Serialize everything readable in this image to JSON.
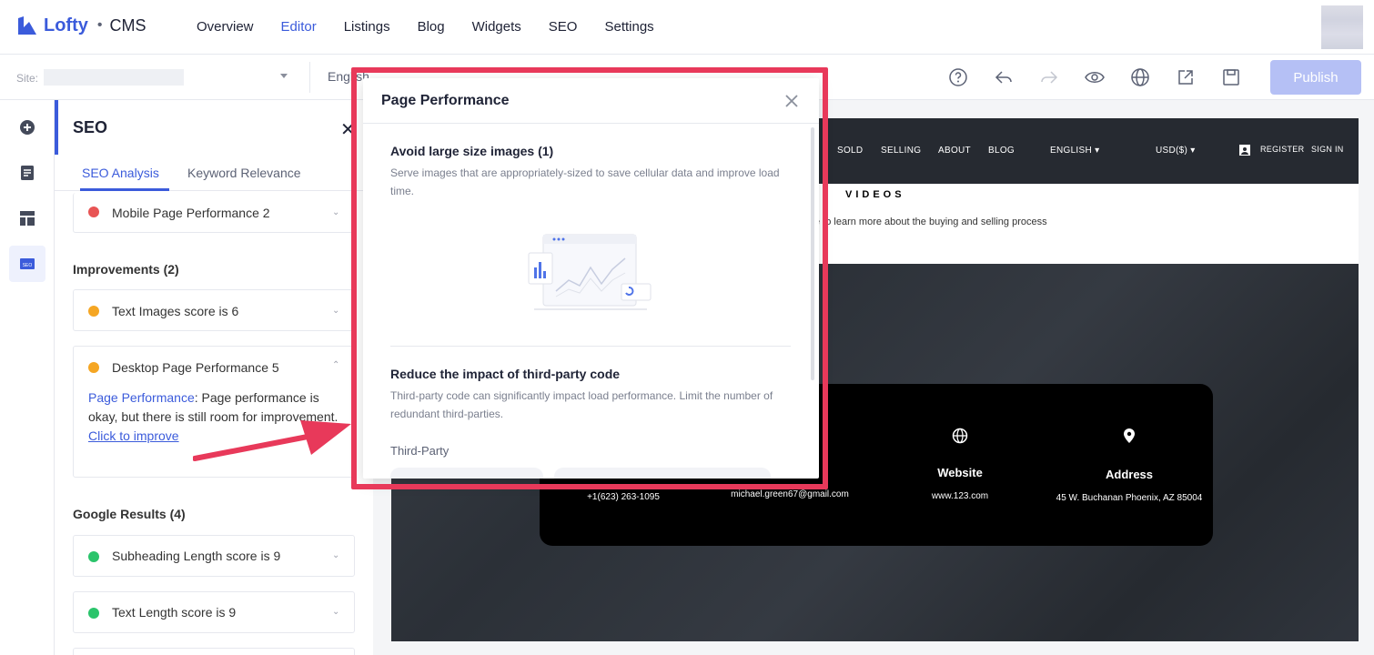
{
  "app": {
    "brand": "Lofty",
    "separator": "•",
    "product": "CMS",
    "accent": "#3b5bdb"
  },
  "nav": {
    "items": [
      "Overview",
      "Editor",
      "Listings",
      "Blog",
      "Widgets",
      "SEO",
      "Settings"
    ],
    "active": "Editor"
  },
  "toolbar": {
    "site_label": "Site:",
    "language": "English",
    "icons": [
      "help-icon",
      "undo-icon",
      "redo-icon",
      "preview-eye-icon",
      "globe-icon",
      "share-icon",
      "save-icon"
    ],
    "publish_label": "Publish"
  },
  "rail": {
    "icons": [
      "add-icon",
      "page-icon",
      "layout-icon",
      "seo-icon"
    ],
    "active": "seo-icon"
  },
  "seo_panel": {
    "title": "SEO",
    "close": "✕",
    "tabs": [
      "SEO Analysis",
      "Keyword Relevance"
    ],
    "top_item": {
      "label": "Mobile Page Performance 2",
      "status": "red"
    },
    "improvements": {
      "heading": "Improvements (2)",
      "items": [
        {
          "label": "Text Images score is 6",
          "status": "orange"
        },
        {
          "label": "Desktop Page Performance 5",
          "status": "orange",
          "expanded": true
        }
      ],
      "expanded_detail": {
        "link_label": "Page Performance",
        "text": ": Page performance is okay, but there is still room for improvement.",
        "action": "Click to improve"
      }
    },
    "google_results": {
      "heading": "Google Results (4)",
      "items": [
        {
          "label": "Subheading Length score is 9",
          "status": "green"
        },
        {
          "label": "Text Length score is 9",
          "status": "green"
        }
      ]
    }
  },
  "preview": {
    "nav": [
      "SOLD",
      "SELLING",
      "ABOUT",
      "BLOG",
      "ENGLISH ▾",
      "USD($) ▾",
      "REGISTER",
      "SIGN IN"
    ],
    "section_title": "VIDEOS",
    "section_sub": "e to learn more about the buying and selling process",
    "contact": [
      {
        "title": "",
        "value": "+1(623) 263-1095"
      },
      {
        "title": "",
        "value": "michael.green67@gmail.com"
      },
      {
        "title": "Website",
        "value": "www.123.com"
      },
      {
        "title": "Address",
        "value": "45 W. Buchanan Phoenix, AZ 85004"
      }
    ]
  },
  "modal": {
    "title": "Page Performance",
    "sections": [
      {
        "heading": "Avoid large size images (1)",
        "text": "Serve images that are appropriately-sized to save cellular data and improve load time."
      },
      {
        "heading": "Reduce the impact of third-party code",
        "text": "Third-party code can significantly impact load performance. Limit the number of redundant third-parties."
      }
    ],
    "sub_heading": "Third-Party"
  },
  "annotation": {
    "color": "#e8395a"
  }
}
